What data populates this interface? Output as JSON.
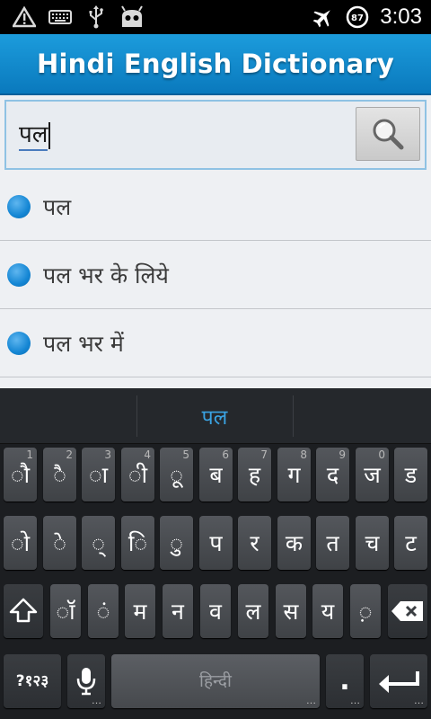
{
  "status_bar": {
    "time": "3:03",
    "battery_level": "87",
    "left_icons": [
      "warning-icon",
      "keyboard-icon",
      "usb-icon",
      "android-icon"
    ],
    "right_icons": [
      "airplane-mode-icon",
      "battery-icon"
    ]
  },
  "app": {
    "title": "Hindi English Dictionary"
  },
  "search": {
    "value": "पल",
    "button_icon": "search-icon"
  },
  "results": [
    {
      "text": "पल"
    },
    {
      "text": "पल भर के लिये"
    },
    {
      "text": "पल भर में"
    }
  ],
  "keyboard": {
    "suggestion": "पल",
    "row1": [
      {
        "label": "ौ",
        "hint": "1"
      },
      {
        "label": "ै",
        "hint": "2"
      },
      {
        "label": "ा",
        "hint": "3"
      },
      {
        "label": "ी",
        "hint": "4"
      },
      {
        "label": "ू",
        "hint": "5"
      },
      {
        "label": "ब",
        "hint": "6"
      },
      {
        "label": "ह",
        "hint": "7"
      },
      {
        "label": "ग",
        "hint": "8"
      },
      {
        "label": "द",
        "hint": "9"
      },
      {
        "label": "ज",
        "hint": "0"
      },
      {
        "label": "ड",
        "hint": ""
      }
    ],
    "row2": [
      {
        "label": "ो"
      },
      {
        "label": "े"
      },
      {
        "label": "्"
      },
      {
        "label": "ि"
      },
      {
        "label": "ु"
      },
      {
        "label": "प"
      },
      {
        "label": "र"
      },
      {
        "label": "क"
      },
      {
        "label": "त"
      },
      {
        "label": "च"
      },
      {
        "label": "ट"
      }
    ],
    "row3": [
      {
        "label": "ॉ"
      },
      {
        "label": "ं"
      },
      {
        "label": "म"
      },
      {
        "label": "न"
      },
      {
        "label": "व"
      },
      {
        "label": "ल"
      },
      {
        "label": "स"
      },
      {
        "label": "य"
      },
      {
        "label": "़"
      }
    ],
    "symbols_label": "?१२३",
    "space_label": "हिन्दी",
    "period_label": "."
  }
}
